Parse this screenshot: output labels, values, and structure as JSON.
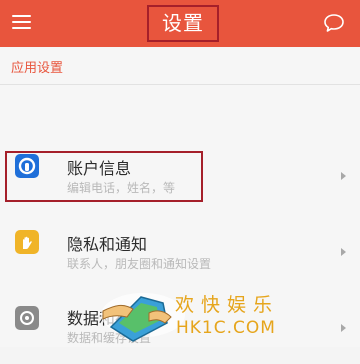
{
  "app_bar": {
    "title": "设置",
    "menu_icon": "hamburger-menu-icon",
    "chat_icon": "chat-bubble-icon",
    "background_color": "#e8553d"
  },
  "section": {
    "header": "应用设置"
  },
  "items": [
    {
      "title": "账户信息",
      "subtitle": "编辑电话，姓名，等",
      "icon": "account-icon",
      "icon_color": "#1f6fd9"
    },
    {
      "title": "隐私和通知",
      "subtitle": "联系人，朋友圈和通知设置",
      "icon": "hand-icon",
      "icon_color": "#f0b428"
    },
    {
      "title": "数据和存储",
      "subtitle": "数据和缓存设置",
      "icon": "storage-icon",
      "icon_color": "#8a8a8a"
    }
  ],
  "watermark": {
    "line1": "欢快娱乐",
    "line2": "HK1C.COM"
  },
  "highlight_color": "#a51f2a"
}
